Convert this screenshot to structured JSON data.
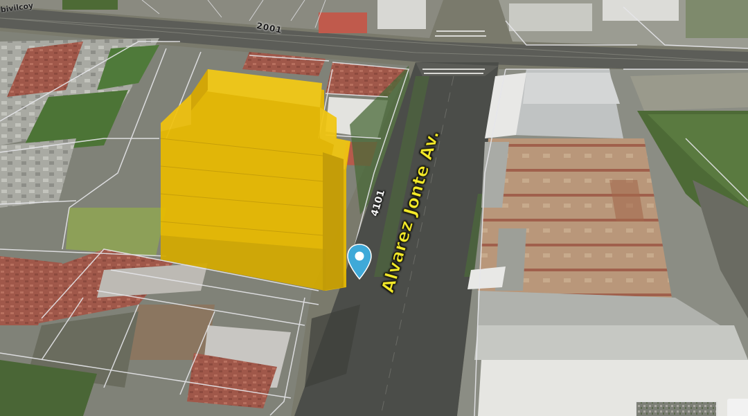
{
  "map": {
    "view": "3D satellite",
    "streets": {
      "avenue_name": "Alvarez Jonte Av.",
      "address_number": "4101",
      "cross_street_number": "2001",
      "cross_street_fragment": "bivilcoy"
    },
    "highlighted_building": {
      "color": "#f5c800"
    },
    "marker": {
      "icon": "location-pin-icon",
      "color": "#3fa9d8"
    }
  }
}
